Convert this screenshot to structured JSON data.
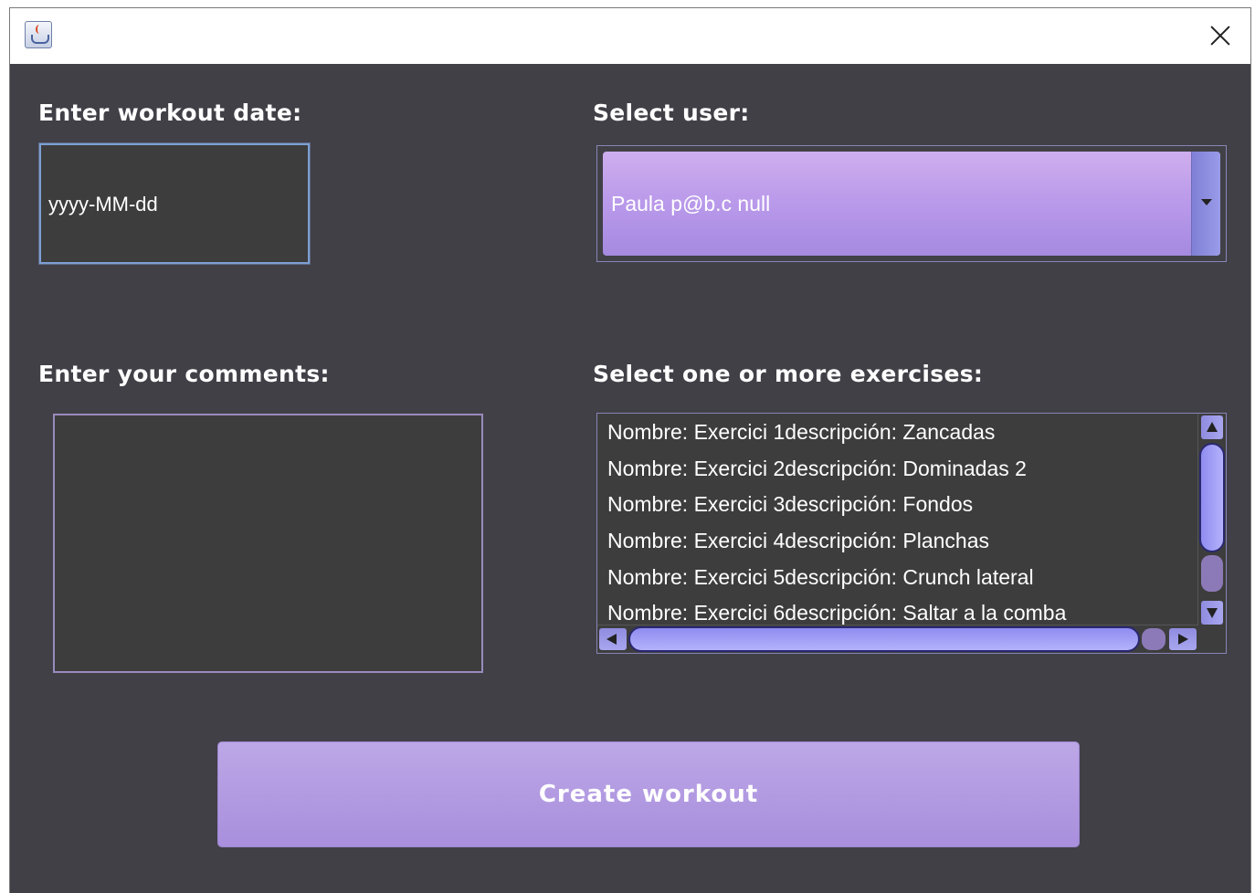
{
  "window": {
    "title": ""
  },
  "icons": {
    "app": "java-coffee-icon",
    "close": "close-icon"
  },
  "labels": {
    "date": "Enter workout date:",
    "user": "Select user:",
    "comments": "Enter your comments:",
    "exercises": "Select one or more exercises:"
  },
  "date_input": {
    "value": "yyyy-MM-dd"
  },
  "user_select": {
    "selected": "Paula p@b.c null"
  },
  "comments_input": {
    "value": ""
  },
  "exercises": [
    "Nombre: Exercici 1descripción: Zancadas",
    "Nombre: Exercici 2descripción: Dominadas 2",
    "Nombre: Exercici 3descripción: Fondos",
    "Nombre: Exercici 4descripción: Planchas",
    "Nombre: Exercici 5descripción: Crunch lateral",
    "Nombre: Exercici 6descripción: Saltar a la comba"
  ],
  "create_button": {
    "label": "Create workout"
  },
  "colors": {
    "background": "#414047",
    "accent": "#b999ea",
    "field": "#3d3d3d"
  }
}
